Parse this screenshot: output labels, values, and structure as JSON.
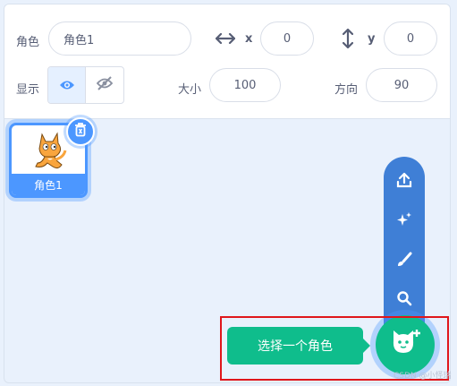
{
  "sprite_info": {
    "sprite_label": "角色",
    "sprite_name": "角色1",
    "x_label": "x",
    "x_value": "0",
    "y_label": "y",
    "y_value": "0",
    "show_label": "显示",
    "size_label": "大小",
    "size_value": "100",
    "direction_label": "方向",
    "direction_value": "90"
  },
  "sprites": [
    {
      "name": "角色1",
      "icon": "cat-sprite-icon",
      "selected": true
    }
  ],
  "add_menu": {
    "items": [
      "upload-icon",
      "sparkle-icon",
      "paint-brush-icon",
      "search-icon"
    ],
    "main_icon": "cat-plus-icon",
    "tooltip": "选择一个角色"
  },
  "watermark": "CSDN @小怪瑞",
  "colors": {
    "accent": "#4c97ff",
    "menu_blue": "#3f7fd6",
    "green": "#0fbd8c",
    "highlight_red": "#e0161b"
  }
}
